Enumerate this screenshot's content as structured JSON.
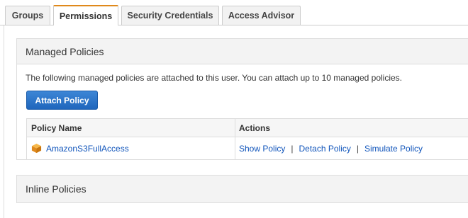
{
  "tabs": [
    {
      "label": "Groups"
    },
    {
      "label": "Permissions"
    },
    {
      "label": "Security Credentials"
    },
    {
      "label": "Access Advisor"
    }
  ],
  "active_tab": "Permissions",
  "managed_policies": {
    "title": "Managed Policies",
    "description": "The following managed policies are attached to this user. You can attach up to 10 managed policies.",
    "attach_button": "Attach Policy",
    "table": {
      "headers": [
        "Policy Name",
        "Actions"
      ],
      "rows": [
        {
          "policy_name": "AmazonS3FullAccess",
          "icon": "policy-cube-icon",
          "actions": [
            "Show Policy",
            "Detach Policy",
            "Simulate Policy"
          ]
        }
      ]
    }
  },
  "inline_policies": {
    "title": "Inline Policies"
  },
  "colors": {
    "active_tab_accent": "#e0891b",
    "primary_button": "#1f66bd",
    "link": "#1155bb",
    "policy_icon": "#f0a030"
  }
}
